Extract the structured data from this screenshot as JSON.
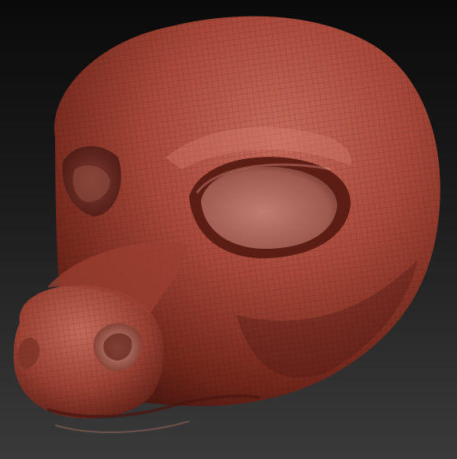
{
  "viewport": {
    "background_top": "#0a0a0a",
    "background_bottom": "#3a3a3a"
  },
  "model": {
    "material_color": "#a8483a",
    "highlight_color": "#d98474",
    "shadow_color": "#4a1710",
    "wireframe_visible": true
  }
}
